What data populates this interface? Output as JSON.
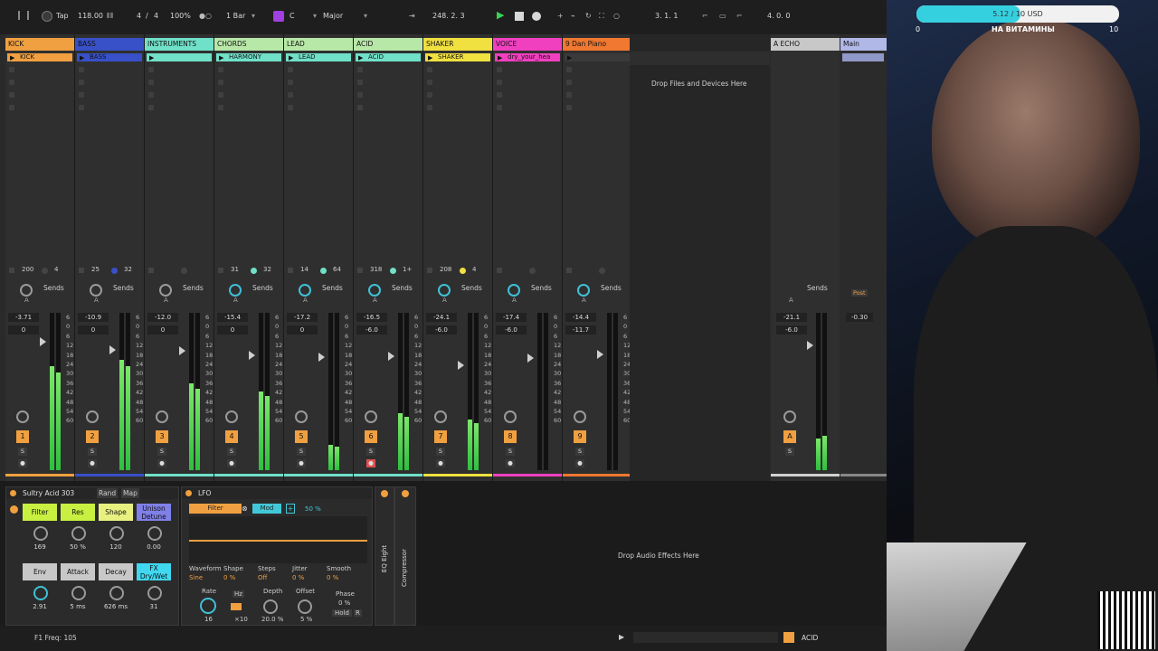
{
  "transport": {
    "tap": "Tap",
    "tempo": "118.00",
    "signature_num": "4",
    "signature_sep": "/",
    "signature_den": "4",
    "zoom": "100%",
    "quantize": "1 Bar",
    "key": "C",
    "scale": "Major",
    "position": "248.  2.  3",
    "loop_start": "3.  1.  1",
    "loop_length": "4.  0.  0"
  },
  "tracks": [
    {
      "name": "KICK",
      "color": "#f0a040",
      "clip": "KICK",
      "clip_color": "#f0a040",
      "io_a": "200",
      "io_b": "4",
      "vol": "-3.71",
      "pan": "0",
      "num": "1",
      "meter": 0.66,
      "bar_color": "#f0a040",
      "dot": "#444"
    },
    {
      "name": "BASS",
      "color": "#3850c8",
      "clip": "BASS",
      "clip_color": "#3850c8",
      "io_a": "25",
      "io_b": "32",
      "vol": "-10.9",
      "pan": "0",
      "num": "2",
      "meter": 0.7,
      "bar_color": "#3850c8",
      "dot": "#3850c8"
    },
    {
      "name": "INSTRUMENTS",
      "color": "#70e0c8",
      "clip": "",
      "clip_color": "#70e0c8",
      "io_a": "",
      "io_b": "",
      "vol": "-12.0",
      "pan": "0",
      "num": "3",
      "meter": 0.55,
      "bar_color": "#70e0c8",
      "dot": "#444"
    },
    {
      "name": "CHORDS",
      "color": "#b8e8a8",
      "clip": "HARMONY",
      "clip_color": "#70e0c8",
      "io_a": "31",
      "io_b": "32",
      "vol": "-15.4",
      "pan": "0",
      "num": "4",
      "meter": 0.5,
      "bar_color": "#70e0c8",
      "dot": "#70e0c8"
    },
    {
      "name": "LEAD",
      "color": "#b8e8a8",
      "clip": "LEAD",
      "clip_color": "#70e0c8",
      "io_a": "14",
      "io_b": "64",
      "vol": "-17.2",
      "pan": "0",
      "num": "5",
      "meter": 0.16,
      "bar_color": "#70e0c8",
      "dot": "#70e0c8"
    },
    {
      "name": "ACID",
      "color": "#b8e8a8",
      "clip": "ACID",
      "clip_color": "#70e0c8",
      "io_a": "318",
      "io_b": "1+",
      "vol": "-16.5",
      "pan": "-6.0",
      "num": "6",
      "meter": 0.36,
      "bar_color": "#70e0c8",
      "dot": "#70e0c8"
    },
    {
      "name": "SHAKER",
      "color": "#f0e040",
      "clip": "SHAKER",
      "clip_color": "#f0e040",
      "io_a": "208",
      "io_b": "4",
      "vol": "-24.1",
      "pan": "-6.0",
      "num": "7",
      "meter": 0.32,
      "bar_color": "#f0e040",
      "dot": "#f0e040"
    },
    {
      "name": "VOICE",
      "color": "#f040c0",
      "clip": "dry_your_hea",
      "clip_color": "#f040c0",
      "io_a": "",
      "io_b": "",
      "vol": "-17.4",
      "pan": "-6.0",
      "num": "8",
      "meter": 0.0,
      "bar_color": "#f040c0",
      "dot": "#444"
    },
    {
      "name": "9 Dan Piano",
      "color": "#f07830",
      "clip": "",
      "clip_color": "",
      "io_a": "",
      "io_b": "",
      "vol": "-14.4",
      "pan": "-11.7",
      "num": "9",
      "meter": 0.0,
      "bar_color": "#f07830",
      "dot": "#444"
    }
  ],
  "sends_label": "Sends",
  "send_letter": "A",
  "solo_letter": "S",
  "meter_scale": [
    "6",
    "0",
    "6",
    "12",
    "18",
    "24",
    "30",
    "36",
    "42",
    "48",
    "54",
    "60"
  ],
  "drop_files": "Drop Files and Devices Here",
  "returns": [
    {
      "name": "A ECHO",
      "vol": "-21.1",
      "pan": "-6.0",
      "letter": "A"
    },
    {
      "name": "Main",
      "vol": "-0.30",
      "pan": "",
      "letter": ""
    }
  ],
  "post_label": "Post",
  "devices": {
    "synth_title": "Sultry Acid 303",
    "rand": "Rand",
    "map": "Map",
    "macros_top": [
      {
        "label": "Filter",
        "color": "#c8f040",
        "value": "169"
      },
      {
        "label": "Res",
        "color": "#c8f040",
        "value": "50 %"
      },
      {
        "label": "Shape",
        "color": "#e8f080",
        "value": "120"
      },
      {
        "label": "Unison Detune",
        "color": "#8080e8",
        "value": "0.00"
      }
    ],
    "macros_bottom": [
      {
        "label": "Env",
        "color": "#c8c8c8",
        "value": "2.91"
      },
      {
        "label": "Attack",
        "color": "#c8c8c8",
        "value": "5 ms"
      },
      {
        "label": "Decay",
        "color": "#c8c8c8",
        "value": "626 ms"
      },
      {
        "label": "FX Dry/Wet",
        "color": "#40d8f0",
        "value": "31"
      }
    ],
    "lfo_title": "LFO",
    "lfo_target": "Filter",
    "lfo_mod": "Mod",
    "lfo_amount": "50 %",
    "lfo_params": [
      {
        "label": "Waveform",
        "value": "Sine"
      },
      {
        "label": "Shape",
        "value": "0 %"
      },
      {
        "label": "Steps",
        "value": "Off"
      },
      {
        "label": "Jitter",
        "value": "0 %"
      },
      {
        "label": "Smooth",
        "value": "0 %"
      }
    ],
    "lfo_rate_label": "Rate",
    "lfo_rate": "16",
    "lfo_hz": "Hz",
    "lfo_x10": "×10",
    "lfo_depth_label": "Depth",
    "lfo_depth": "20.0 %",
    "lfo_offset_label": "Offset",
    "lfo_offset": "5 %",
    "lfo_phase_label": "Phase",
    "lfo_phase": "0 %",
    "lfo_hold": "Hold",
    "lfo_r": "R",
    "eq_name": "EQ Eight",
    "comp_name": "Compressor",
    "drop_effects": "Drop Audio Effects Here"
  },
  "status": {
    "info": "F1 Freq: 105",
    "track_name": "ACID"
  },
  "donation": {
    "text": "5.12 / 10 USD",
    "min": "0",
    "caption": "НА ВИТАМИНЫ",
    "max": "10",
    "progress": 0.512
  }
}
